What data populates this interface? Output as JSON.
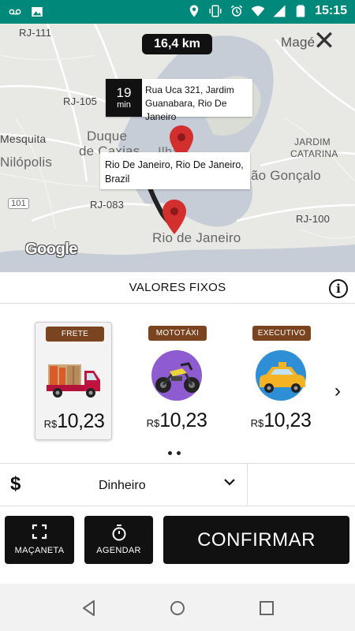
{
  "status_bar": {
    "time": "15:15",
    "icons": [
      "voicemail-icon",
      "image-icon",
      "location-icon",
      "vibrate-icon",
      "alarm-icon",
      "wifi-icon",
      "signal-icon",
      "battery-icon"
    ],
    "bg_color": "#00897b"
  },
  "map": {
    "distance": "16,4 km",
    "eta": {
      "number": "19",
      "unit": "min",
      "address": "Rua Uca 321, Jardim Guanabara, Rio De Janeiro"
    },
    "destination": "Rio De Janeiro, Rio De Janeiro, Brazil",
    "labels": {
      "rj111": "RJ-111",
      "mage": "Magé",
      "rj105": "RJ-105",
      "mesquita": "Mesquita",
      "duque": "Duque",
      "de_caxias": "de Caxias",
      "nilopolis": "Nilópolis",
      "ilha": "Ilha",
      "jardim_catarina_1": "JARDIM",
      "jardim_catarina_2": "CATARINA",
      "sao_goncalo": "ão Gonçalo",
      "r101": "101",
      "rj083": "RJ-083",
      "rj100": "RJ-100",
      "rio": "Rio de Janeiro"
    },
    "attribution": "Google",
    "route_color": "#222222",
    "pin_color": "#d32f2f"
  },
  "fixed_values": {
    "title": "VALORES FIXOS",
    "info_icon": "i"
  },
  "vehicles": [
    {
      "badge": "FRETE",
      "currency": "R$",
      "price": "10,23",
      "icon": "truck-icon",
      "selected": true
    },
    {
      "badge": "MOTOTÁXI",
      "currency": "R$",
      "price": "10,23",
      "icon": "motorcycle-icon",
      "selected": false
    },
    {
      "badge": "EXECUTIVO",
      "currency": "R$",
      "price": "10,23",
      "icon": "taxi-icon",
      "selected": false
    }
  ],
  "payment": {
    "symbol": "$",
    "method": "Dinheiro"
  },
  "actions": {
    "macaneta": "MAÇANETA",
    "agendar": "AGENDAR",
    "confirmar": "CONFIRMAR"
  },
  "colors": {
    "badge": "#7a4420",
    "button": "#111111"
  }
}
